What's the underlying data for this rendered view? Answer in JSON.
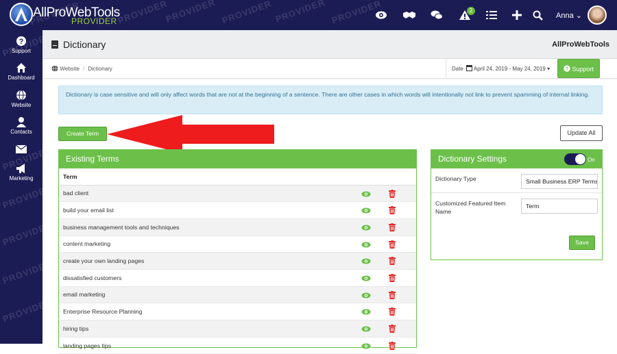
{
  "colors": {
    "navy": "#1c1c55",
    "green": "#6cc04a",
    "info_bg": "#d9edf7",
    "delete_red": "#e52b2b"
  },
  "topbar": {
    "brand": "AllProWebTools",
    "brand_sub": "PROVIDER",
    "watermark": "PROVIDER",
    "icons": [
      "eye-icon",
      "handshake-icon",
      "chat-icon",
      "alert-icon",
      "tasks-icon",
      "plus-icon",
      "search-icon"
    ],
    "alert_count": "2",
    "user_name": "Anna"
  },
  "sidebar": {
    "items": [
      {
        "label": "Support",
        "icon": "question-icon"
      },
      {
        "label": "Dashboard",
        "icon": "home-icon"
      },
      {
        "label": "Website",
        "icon": "globe-icon"
      },
      {
        "label": "Contacts",
        "icon": "user-icon"
      },
      {
        "label": "Marketing",
        "icon": "megaphone-icon"
      }
    ],
    "mail_icon": "envelope-icon"
  },
  "header": {
    "title": "Dictionary",
    "brand_right": "AllProWebTools"
  },
  "breadcrumb": {
    "items": [
      "Website",
      "Dictionary"
    ]
  },
  "date_filter": {
    "label": "Date",
    "range": "April 24, 2019 - May 24, 2019"
  },
  "support_button": "Support",
  "info_message": "Dictionary is case sensitive and will only affect words that are not at the beginning of a sentence. There are other cases in which words will intentionally not link to prevent spamming of internal linking.",
  "buttons": {
    "create": "Create Term",
    "update_all": "Update All",
    "save": "Save"
  },
  "terms_panel": {
    "title": "Existing Terms",
    "column": "Term",
    "rows": [
      "bad client",
      "build your email list",
      "business management tools and techniques",
      "content marketing",
      "create your own landing pages",
      "dissatisfied customers",
      "email marketing",
      "Enterprise Resource Planning",
      "hiring tips",
      "landing pages tips"
    ]
  },
  "settings_panel": {
    "title": "Dictionary Settings",
    "toggle_label": "On",
    "toggle_state": "on",
    "fields": [
      {
        "label": "Dictionary Type",
        "value": "Small Business ERP Terms"
      },
      {
        "label": "Customized Featured Item Name",
        "value": "Term"
      }
    ]
  }
}
